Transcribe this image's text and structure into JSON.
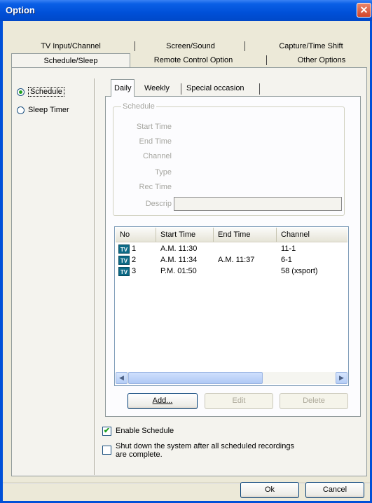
{
  "window": {
    "title": "Option",
    "close_glyph": "✕"
  },
  "tabs_row1": [
    "TV Input/Channel",
    "Screen/Sound",
    "Capture/Time Shift"
  ],
  "tabs_row2": [
    "Schedule/Sleep",
    "Remote Control Option",
    "Other Options"
  ],
  "radios": {
    "schedule": "Schedule",
    "sleep_timer": "Sleep Timer",
    "selected": "schedule"
  },
  "inner_tabs": [
    "Daily",
    "Weekly",
    "Special occasion"
  ],
  "schedule_group": {
    "title": "Schedule",
    "labels": [
      "Start Time",
      "End Time",
      "Channel",
      "Type",
      "Rec Time",
      "Descrip"
    ]
  },
  "list": {
    "columns": [
      "No",
      "Start Time",
      "End Time",
      "Channel"
    ],
    "rows": [
      {
        "icon": "tv-icon",
        "icon_text": "TV",
        "no": "1",
        "start": "A.M. 11:30",
        "end": "",
        "channel": "11-1"
      },
      {
        "icon": "tv-icon",
        "icon_text": "TV",
        "no": "2",
        "start": "A.M. 11:34",
        "end": "A.M. 11:37",
        "channel": "6-1"
      },
      {
        "icon": "tv-icon",
        "icon_text": "TV",
        "no": "3",
        "start": "P.M. 01:50",
        "end": "",
        "channel": "58 (xsport)"
      }
    ],
    "scroll_left": "◀",
    "scroll_right": "▶"
  },
  "buttons": {
    "add": "Add...",
    "edit": "Edit",
    "delete": "Delete",
    "ok": "Ok",
    "cancel": "Cancel"
  },
  "checks": {
    "enable_schedule": {
      "label": "Enable Schedule",
      "checked": true,
      "mark": "✔"
    },
    "shutdown": {
      "label_line1": "Shut down the system after all scheduled recordings",
      "label_line2": "are complete.",
      "checked": false
    }
  }
}
